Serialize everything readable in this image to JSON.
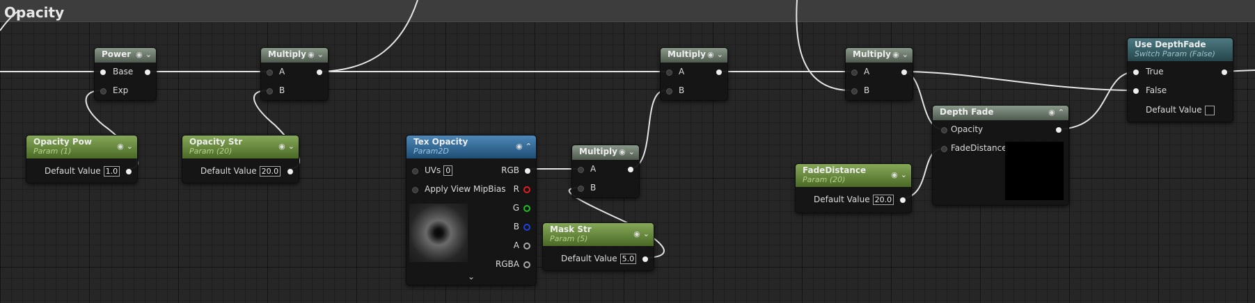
{
  "title": "Opacity",
  "nodes": {
    "power": {
      "title": "Power",
      "in": [
        "Base",
        "Exp"
      ]
    },
    "multiply1": {
      "title": "Multiply",
      "in": [
        "A",
        "B"
      ]
    },
    "multiply2": {
      "title": "Multiply",
      "in": [
        "A",
        "B"
      ]
    },
    "multiply3": {
      "title": "Multiply",
      "in": [
        "A",
        "B"
      ]
    },
    "multiply4": {
      "title": "Multiply",
      "in": [
        "A",
        "B"
      ]
    },
    "opacity_pow": {
      "title": "Opacity Pow",
      "subtitle": "Param (1)",
      "label": "Default Value",
      "value": "1.0"
    },
    "opacity_str": {
      "title": "Opacity Str",
      "subtitle": "Param (20)",
      "label": "Default Value",
      "value": "20.0"
    },
    "tex_opacity": {
      "title": "Tex Opacity",
      "subtitle": "Param2D",
      "uvs_label": "UVs",
      "uvs_value": "0",
      "mipbias_label": "Apply View MipBias",
      "outputs": [
        "RGB",
        "R",
        "G",
        "B",
        "A",
        "RGBA"
      ]
    },
    "mask_str": {
      "title": "Mask Str",
      "subtitle": "Param (5)",
      "label": "Default Value",
      "value": "5.0"
    },
    "fade_distance": {
      "title": "FadeDistance",
      "subtitle": "Param (20)",
      "label": "Default Value",
      "value": "20.0"
    },
    "depth_fade": {
      "title": "Depth Fade",
      "in": [
        "Opacity",
        "FadeDistance"
      ]
    },
    "use_depthfade": {
      "title": "Use DepthFade",
      "subtitle": "Switch Param (False)",
      "in": [
        "True",
        "False"
      ],
      "label": "Default Value"
    }
  },
  "pin_colors": {
    "R": "#e02020",
    "G": "#20c020",
    "B": "#2040e0",
    "A": "#bbbbbb",
    "RGBA": "#bbbbbb"
  }
}
